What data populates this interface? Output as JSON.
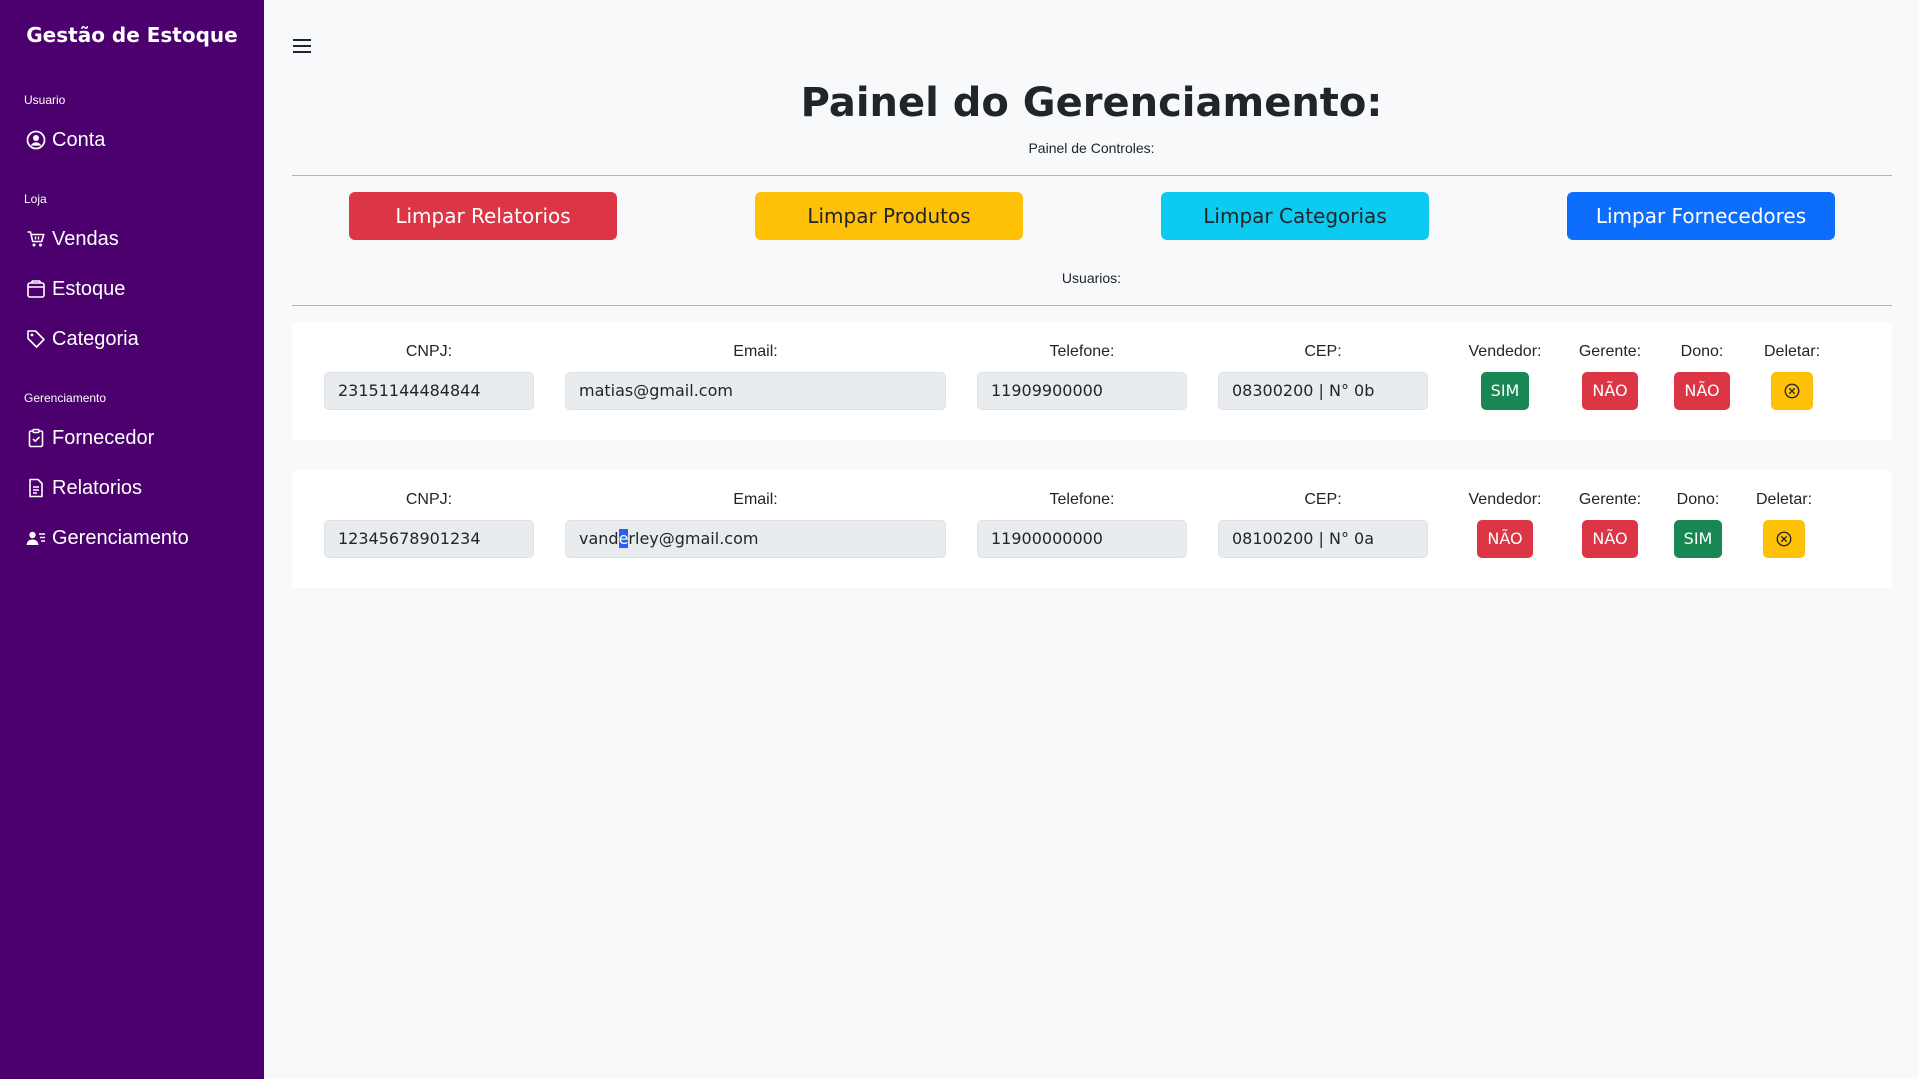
{
  "sidebar": {
    "brand": "Gestão de Estoque",
    "sections": [
      {
        "label": "Usuario"
      },
      {
        "label": "Loja"
      },
      {
        "label": "Gerenciamento"
      }
    ],
    "items": [
      {
        "label": "Conta",
        "icon": "person-circle-icon"
      },
      {
        "label": "Vendas",
        "icon": "cart-icon"
      },
      {
        "label": "Estoque",
        "icon": "box-icon"
      },
      {
        "label": "Categoria",
        "icon": "tag-icon"
      },
      {
        "label": "Fornecedor",
        "icon": "clipboard-check-icon"
      },
      {
        "label": "Relatorios",
        "icon": "document-icon"
      },
      {
        "label": "Gerenciamento",
        "icon": "person-lines-icon"
      }
    ]
  },
  "main": {
    "title": "Painel do Gerenciamento:",
    "controls_label": "Painel de Controles:",
    "users_label": "Usuarios:",
    "buttons": [
      {
        "label": "Limpar Relatorios",
        "color": "#dc3545"
      },
      {
        "label": "Limpar Produtos",
        "color": "#ffc107"
      },
      {
        "label": "Limpar Categorias",
        "color": "#0dcaf0"
      },
      {
        "label": "Limpar Fornecedores",
        "color": "#0d6efd"
      }
    ],
    "columns": {
      "cnpj": "CNPJ:",
      "email": "Email:",
      "telefone": "Telefone:",
      "cep": "CEP:",
      "vendedor": "Vendedor:",
      "gerente": "Gerente:",
      "dono": "Dono:",
      "deletar": "Deletar:"
    },
    "users": [
      {
        "cnpj": "23151144484844",
        "email": "matias@gmail.com",
        "telefone": "11909900000",
        "cep": "08300200 | N° 0b",
        "vendedor": "SIM",
        "gerente": "NÃO",
        "dono": "NÃO"
      },
      {
        "cnpj": "12345678901234",
        "email_before": "vand",
        "email_selected": "e",
        "email_after": "rley@gmail.com",
        "telefone": "11900000000",
        "cep": "08100200 | N° 0a",
        "vendedor": "NÃO",
        "gerente": "NÃO",
        "dono": "SIM"
      }
    ]
  },
  "colors": {
    "sidebar": "#4b006e",
    "sim": "#198754",
    "nao": "#dc3545",
    "delete": "#ffc107"
  }
}
